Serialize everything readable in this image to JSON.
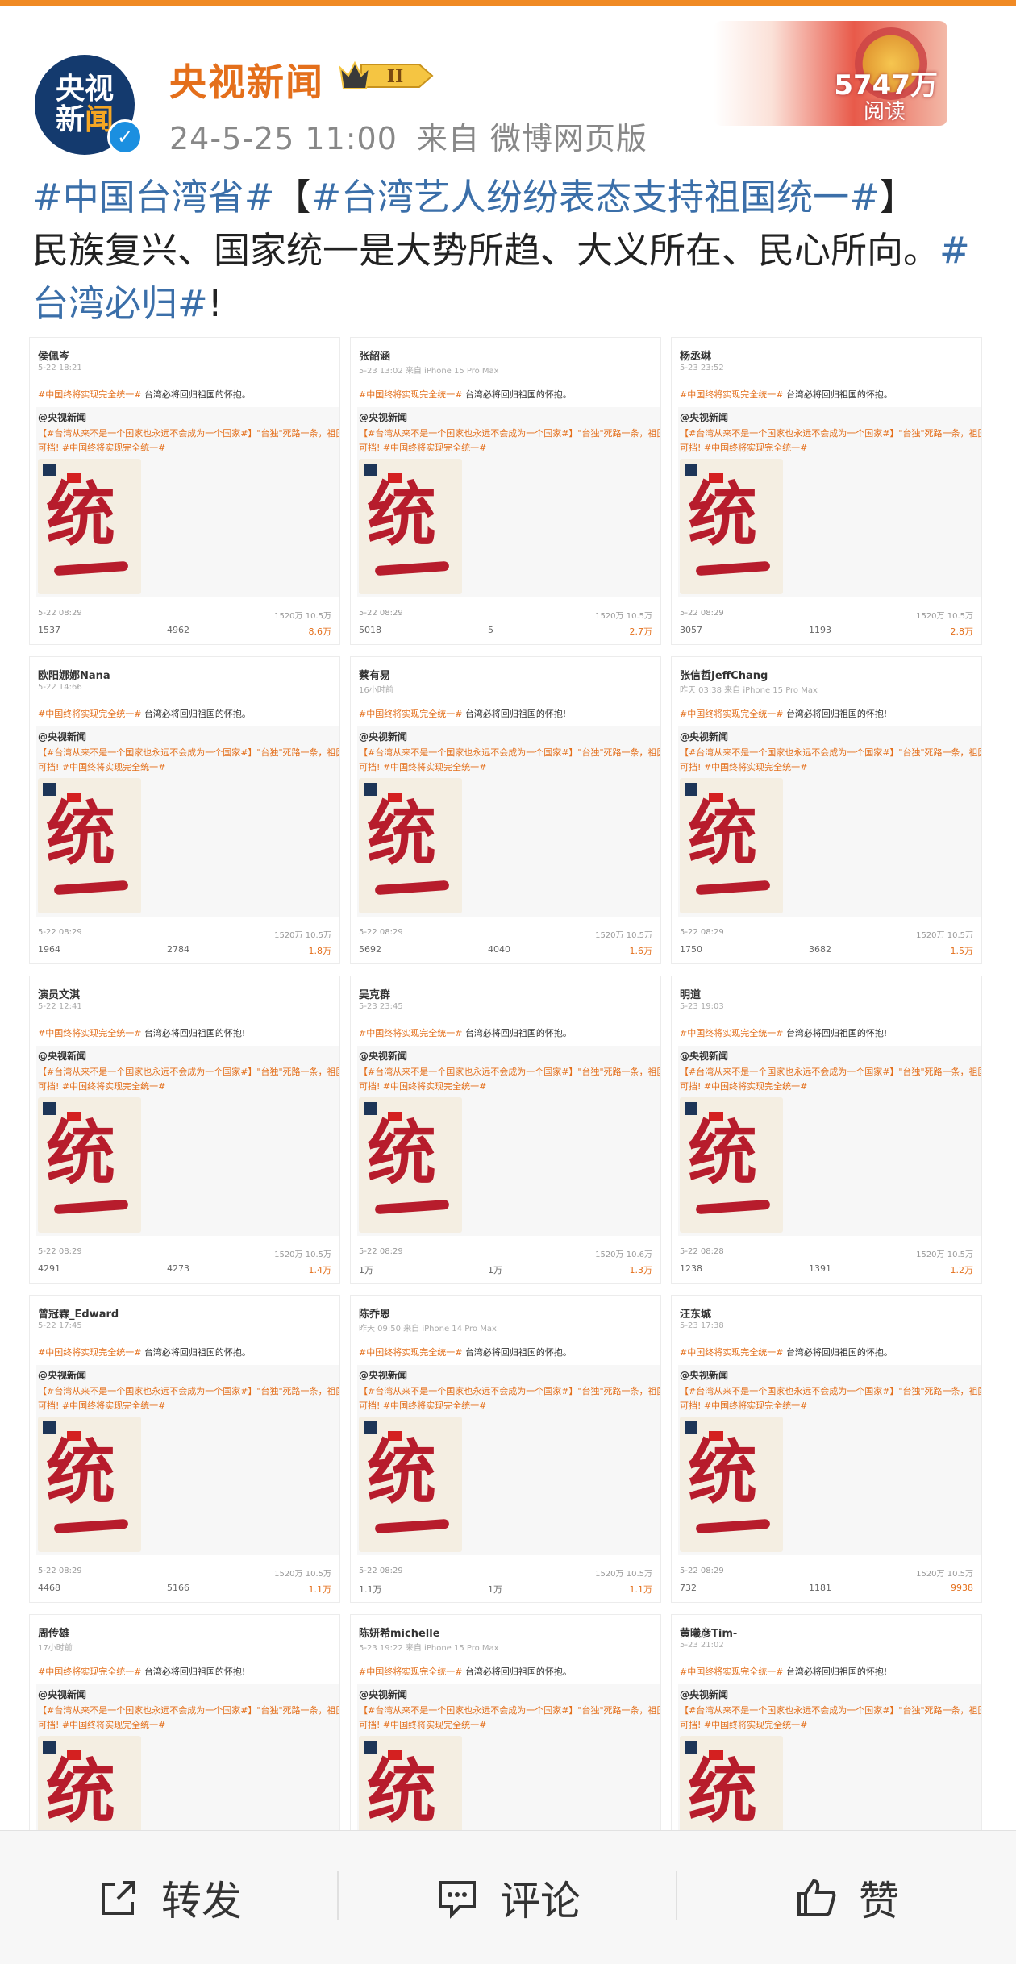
{
  "header": {
    "name": "央视新闻",
    "vip_level": "II",
    "time": "24-5-25 11:00",
    "source": "来自 微博网页版",
    "read_count": "5747万",
    "read_label": "阅读",
    "avatar_line1": "央视",
    "avatar_line2_a": "新",
    "avatar_line2_b": "闻"
  },
  "post": {
    "tag1": "#中国台湾省#",
    "bracket_open": "【",
    "tag2": "#台湾艺人纷纷表态支持祖国统一#",
    "bracket_close": "】",
    "body": "民族复兴、国家统一是大势所趋、大义所在、民心所向。",
    "tag3": "#台湾必归#",
    "end": "!"
  },
  "cards": [
    {
      "name": "侯佩岑",
      "time": "5-22 18:21",
      "text": "台湾必将回归祖国的怀抱。",
      "f1": "1537",
      "f2": "4962",
      "f3": "8.6万",
      "qd": "5-22 08:29",
      "qs": "1520万  10.5万"
    },
    {
      "name": "张韶涵",
      "time": "5-23 13:02 来自 iPhone 15 Pro Max",
      "text": "台湾必将回归祖国的怀抱。",
      "f1": "5018",
      "f2": "5",
      "f3": "2.7万",
      "qd": "5-22 08:29",
      "qs": "1520万  10.5万"
    },
    {
      "name": "杨丞琳",
      "time": "5-23 23:52",
      "text": "台湾必将回归祖国的怀抱。",
      "f1": "3057",
      "f2": "1193",
      "f3": "2.8万",
      "qd": "5-22 08:29",
      "qs": "1520万  10.5万"
    },
    {
      "name": "欧阳娜娜Nana",
      "time": "5-22 14:66",
      "text": "台湾必将回归祖国的怀抱。",
      "f1": "1964",
      "f2": "2784",
      "f3": "1.8万",
      "qd": "5-22 08:29",
      "qs": "1520万  10.5万"
    },
    {
      "name": "蔡有易",
      "time": "16小时前",
      "text": "台湾必将回归祖国的怀抱!",
      "f1": "5692",
      "f2": "4040",
      "f3": "1.6万",
      "qd": "5-22 08:29",
      "qs": "1520万  10.5万"
    },
    {
      "name": "张信哲JeffChang",
      "time": "昨天 03:38 来自 iPhone 15 Pro Max",
      "text": "台湾必将回归祖国的怀抱!",
      "f1": "1750",
      "f2": "3682",
      "f3": "1.5万",
      "qd": "5-22 08:29",
      "qs": "1520万  10.5万"
    },
    {
      "name": "演员文淇",
      "time": "5-22 12:41",
      "text": "台湾必将回归祖国的怀抱!",
      "f1": "4291",
      "f2": "4273",
      "f3": "1.4万",
      "qd": "5-22 08:29",
      "qs": "1520万  10.5万"
    },
    {
      "name": "吴克群",
      "time": "5-23 23:45",
      "text": "台湾必将回归祖国的怀抱。",
      "f1": "1万",
      "f2": "1万",
      "f3": "1.3万",
      "qd": "5-22 08:29",
      "qs": "1520万  10.6万"
    },
    {
      "name": "明道",
      "time": "5-23 19:03",
      "text": "台湾必将回归祖国的怀抱!",
      "f1": "1238",
      "f2": "1391",
      "f3": "1.2万",
      "qd": "5-22 08:28",
      "qs": "1520万  10.5万"
    },
    {
      "name": "曾冠霖_Edward",
      "time": "5-22 17:45",
      "text": "台湾必将回归祖国的怀抱。",
      "f1": "4468",
      "f2": "5166",
      "f3": "1.1万",
      "qd": "5-22 08:29",
      "qs": "1520万  10.5万"
    },
    {
      "name": "陈乔恩",
      "time": "昨天 09:50 来自 iPhone 14 Pro Max",
      "text": "台湾必将回归祖国的怀抱。",
      "f1": "1.1万",
      "f2": "1万",
      "f3": "1.1万",
      "qd": "5-22 08:29",
      "qs": "1520万  10.5万"
    },
    {
      "name": "汪东城",
      "time": "5-23 17:38",
      "text": "台湾必将回归祖国的怀抱。",
      "f1": "732",
      "f2": "1181",
      "f3": "9938",
      "qd": "5-22 08:29",
      "qs": "1520万  10.5万"
    },
    {
      "name": "周传雄",
      "time": "17小时前",
      "text": "台湾必将回归祖国的怀抱!",
      "f1": "",
      "f2": "",
      "f3": "",
      "qd": "",
      "qs": ""
    },
    {
      "name": "陈妍希michelle",
      "time": "5-23 19:22 来自 iPhone 15 Pro Max",
      "text": "台湾必将回归祖国的怀抱。",
      "f1": "",
      "f2": "",
      "f3": "",
      "qd": "",
      "qs": ""
    },
    {
      "name": "黄曦彦Tim-",
      "time": "5-23 21:02",
      "text": "台湾必将回归祖国的怀抱!",
      "f1": "",
      "f2": "",
      "f3": "",
      "qd": "",
      "qs": ""
    }
  ],
  "card_common": {
    "hashtag": "#中国终将实现完全统一#",
    "quote_name": "@央视新闻",
    "quote_line1": "【#台湾从来不是一个国家也永远不会成为一个国家#】\"台独\"死路一条，祖国统一必然",
    "quote_line2": "可挡! #中国终将实现完全统一#",
    "art_char": "统"
  },
  "actions": {
    "repost": "转发",
    "comment": "评论",
    "like": "赞"
  }
}
